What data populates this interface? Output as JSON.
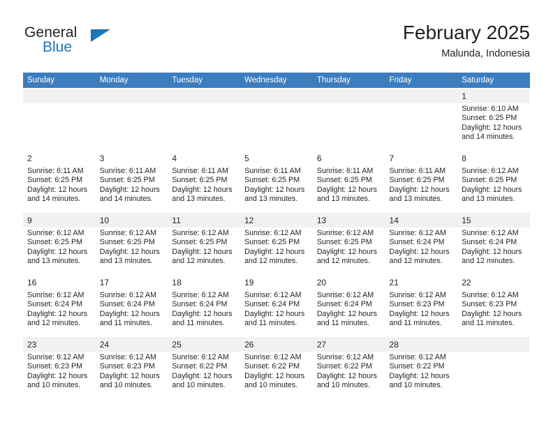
{
  "brand": {
    "name_dark": "General",
    "name_blue": "Blue",
    "accent_color": "#1b75bb"
  },
  "header": {
    "title": "February 2025",
    "subtitle": "Malunda, Indonesia"
  },
  "calendar": {
    "header_color": "#3c7dbf",
    "weekdays": [
      "Sunday",
      "Monday",
      "Tuesday",
      "Wednesday",
      "Thursday",
      "Friday",
      "Saturday"
    ],
    "labels": {
      "sunrise": "Sunrise:",
      "sunset": "Sunset:",
      "daylight": "Daylight:"
    },
    "weeks": [
      [
        {
          "empty": true
        },
        {
          "empty": true
        },
        {
          "empty": true
        },
        {
          "empty": true
        },
        {
          "empty": true
        },
        {
          "empty": true
        },
        {
          "day": "1",
          "sunrise": "Sunrise: 6:10 AM",
          "sunset": "Sunset: 6:25 PM",
          "daylight": "Daylight: 12 hours and 14 minutes."
        }
      ],
      [
        {
          "day": "2",
          "sunrise": "Sunrise: 6:11 AM",
          "sunset": "Sunset: 6:25 PM",
          "daylight": "Daylight: 12 hours and 14 minutes."
        },
        {
          "day": "3",
          "sunrise": "Sunrise: 6:11 AM",
          "sunset": "Sunset: 6:25 PM",
          "daylight": "Daylight: 12 hours and 14 minutes."
        },
        {
          "day": "4",
          "sunrise": "Sunrise: 6:11 AM",
          "sunset": "Sunset: 6:25 PM",
          "daylight": "Daylight: 12 hours and 13 minutes."
        },
        {
          "day": "5",
          "sunrise": "Sunrise: 6:11 AM",
          "sunset": "Sunset: 6:25 PM",
          "daylight": "Daylight: 12 hours and 13 minutes."
        },
        {
          "day": "6",
          "sunrise": "Sunrise: 6:11 AM",
          "sunset": "Sunset: 6:25 PM",
          "daylight": "Daylight: 12 hours and 13 minutes."
        },
        {
          "day": "7",
          "sunrise": "Sunrise: 6:11 AM",
          "sunset": "Sunset: 6:25 PM",
          "daylight": "Daylight: 12 hours and 13 minutes."
        },
        {
          "day": "8",
          "sunrise": "Sunrise: 6:12 AM",
          "sunset": "Sunset: 6:25 PM",
          "daylight": "Daylight: 12 hours and 13 minutes."
        }
      ],
      [
        {
          "day": "9",
          "sunrise": "Sunrise: 6:12 AM",
          "sunset": "Sunset: 6:25 PM",
          "daylight": "Daylight: 12 hours and 13 minutes."
        },
        {
          "day": "10",
          "sunrise": "Sunrise: 6:12 AM",
          "sunset": "Sunset: 6:25 PM",
          "daylight": "Daylight: 12 hours and 13 minutes."
        },
        {
          "day": "11",
          "sunrise": "Sunrise: 6:12 AM",
          "sunset": "Sunset: 6:25 PM",
          "daylight": "Daylight: 12 hours and 12 minutes."
        },
        {
          "day": "12",
          "sunrise": "Sunrise: 6:12 AM",
          "sunset": "Sunset: 6:25 PM",
          "daylight": "Daylight: 12 hours and 12 minutes."
        },
        {
          "day": "13",
          "sunrise": "Sunrise: 6:12 AM",
          "sunset": "Sunset: 6:25 PM",
          "daylight": "Daylight: 12 hours and 12 minutes."
        },
        {
          "day": "14",
          "sunrise": "Sunrise: 6:12 AM",
          "sunset": "Sunset: 6:24 PM",
          "daylight": "Daylight: 12 hours and 12 minutes."
        },
        {
          "day": "15",
          "sunrise": "Sunrise: 6:12 AM",
          "sunset": "Sunset: 6:24 PM",
          "daylight": "Daylight: 12 hours and 12 minutes."
        }
      ],
      [
        {
          "day": "16",
          "sunrise": "Sunrise: 6:12 AM",
          "sunset": "Sunset: 6:24 PM",
          "daylight": "Daylight: 12 hours and 12 minutes."
        },
        {
          "day": "17",
          "sunrise": "Sunrise: 6:12 AM",
          "sunset": "Sunset: 6:24 PM",
          "daylight": "Daylight: 12 hours and 11 minutes."
        },
        {
          "day": "18",
          "sunrise": "Sunrise: 6:12 AM",
          "sunset": "Sunset: 6:24 PM",
          "daylight": "Daylight: 12 hours and 11 minutes."
        },
        {
          "day": "19",
          "sunrise": "Sunrise: 6:12 AM",
          "sunset": "Sunset: 6:24 PM",
          "daylight": "Daylight: 12 hours and 11 minutes."
        },
        {
          "day": "20",
          "sunrise": "Sunrise: 6:12 AM",
          "sunset": "Sunset: 6:24 PM",
          "daylight": "Daylight: 12 hours and 11 minutes."
        },
        {
          "day": "21",
          "sunrise": "Sunrise: 6:12 AM",
          "sunset": "Sunset: 6:23 PM",
          "daylight": "Daylight: 12 hours and 11 minutes."
        },
        {
          "day": "22",
          "sunrise": "Sunrise: 6:12 AM",
          "sunset": "Sunset: 6:23 PM",
          "daylight": "Daylight: 12 hours and 11 minutes."
        }
      ],
      [
        {
          "day": "23",
          "sunrise": "Sunrise: 6:12 AM",
          "sunset": "Sunset: 6:23 PM",
          "daylight": "Daylight: 12 hours and 10 minutes."
        },
        {
          "day": "24",
          "sunrise": "Sunrise: 6:12 AM",
          "sunset": "Sunset: 6:23 PM",
          "daylight": "Daylight: 12 hours and 10 minutes."
        },
        {
          "day": "25",
          "sunrise": "Sunrise: 6:12 AM",
          "sunset": "Sunset: 6:22 PM",
          "daylight": "Daylight: 12 hours and 10 minutes."
        },
        {
          "day": "26",
          "sunrise": "Sunrise: 6:12 AM",
          "sunset": "Sunset: 6:22 PM",
          "daylight": "Daylight: 12 hours and 10 minutes."
        },
        {
          "day": "27",
          "sunrise": "Sunrise: 6:12 AM",
          "sunset": "Sunset: 6:22 PM",
          "daylight": "Daylight: 12 hours and 10 minutes."
        },
        {
          "day": "28",
          "sunrise": "Sunrise: 6:12 AM",
          "sunset": "Sunset: 6:22 PM",
          "daylight": "Daylight: 12 hours and 10 minutes."
        },
        {
          "empty": true
        }
      ]
    ]
  }
}
